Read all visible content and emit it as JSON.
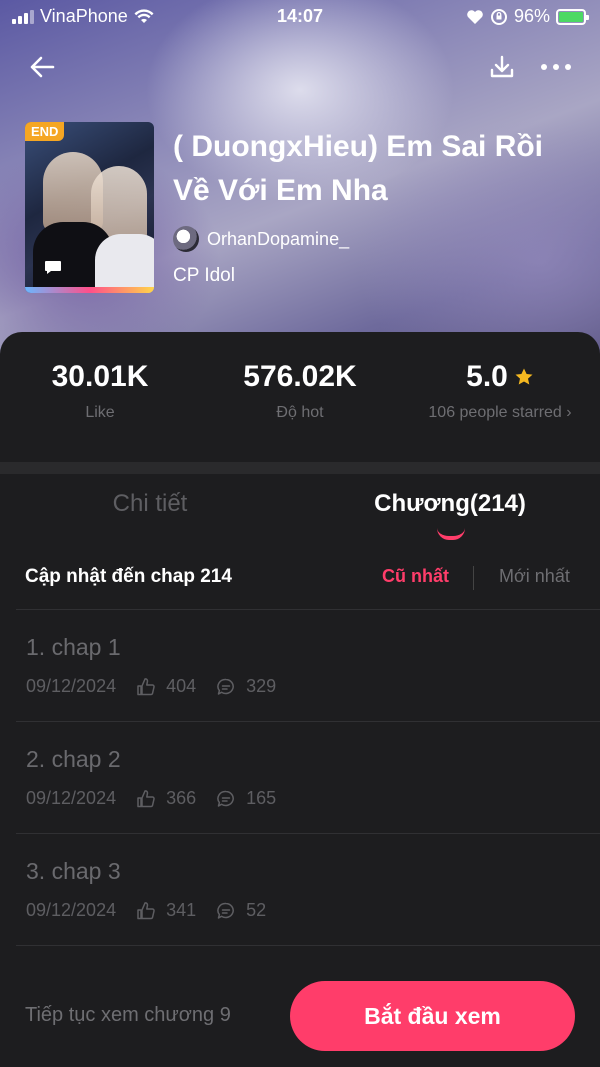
{
  "status_bar": {
    "carrier": "VinaPhone",
    "time": "14:07",
    "battery": "96%"
  },
  "book": {
    "badge": "END",
    "title": "( DuongxHieu) Em Sai Rồi Về Với Em Nha",
    "author": "OrhanDopamine_",
    "genre": "CP Idol"
  },
  "stats": {
    "likes_value": "30.01K",
    "likes_label": "Like",
    "hot_value": "576.02K",
    "hot_label": "Độ hot",
    "rating_value": "5.0",
    "rating_label": "106 people starred ›"
  },
  "tabs": {
    "detail": "Chi tiết",
    "chapters": "Chương(214)"
  },
  "chapter_header": {
    "update_text": "Cập nhật đến chap 214",
    "sort_oldest": "Cũ nhất",
    "sort_newest": "Mới nhất"
  },
  "chapters": [
    {
      "title": "1. chap 1",
      "date": "09/12/2024",
      "likes": "404",
      "comments": "329"
    },
    {
      "title": "2. chap 2",
      "date": "09/12/2024",
      "likes": "366",
      "comments": "165"
    },
    {
      "title": "3. chap 3",
      "date": "09/12/2024",
      "likes": "341",
      "comments": "52"
    }
  ],
  "bottom": {
    "continue_text": "Tiếp tục xem chương 9",
    "start_button": "Bắt đầu xem"
  },
  "colors": {
    "accent": "#ff3d6a",
    "star": "#f5b820",
    "badge": "#f5a623"
  }
}
